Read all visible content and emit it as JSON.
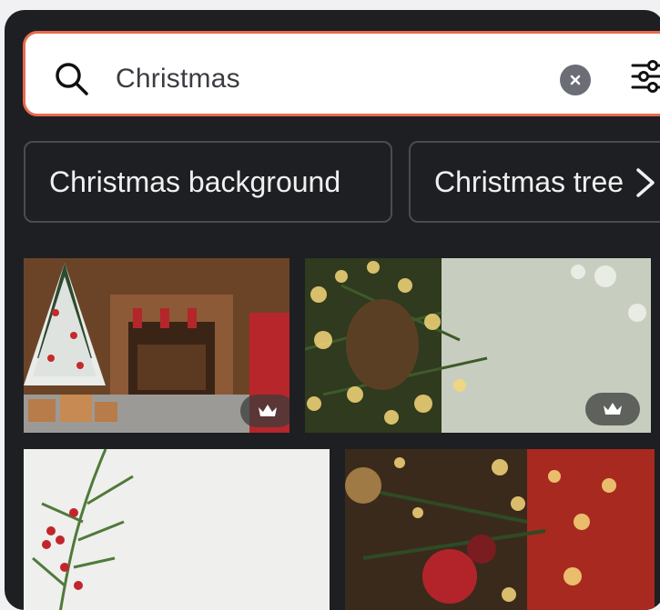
{
  "search": {
    "value": "Christmas",
    "clear_label": "×"
  },
  "suggestions": [
    {
      "label": "Christmas background"
    },
    {
      "label": "Christmas tree"
    }
  ],
  "images": [
    {
      "alt": "Christmas fireplace with tree",
      "premium": true
    },
    {
      "alt": "Pine branch with bokeh lights",
      "premium": true
    },
    {
      "alt": "Holly branch on white",
      "premium": false
    },
    {
      "alt": "Christmas ornaments with lights",
      "premium": false
    }
  ],
  "colors": {
    "panel": "#1e1f22",
    "search_border": "#e86a4f",
    "chip_border": "#4a4c52"
  },
  "icons": [
    "search-icon",
    "clear-icon",
    "filter-icon",
    "chevron-right-icon",
    "crown-icon"
  ]
}
